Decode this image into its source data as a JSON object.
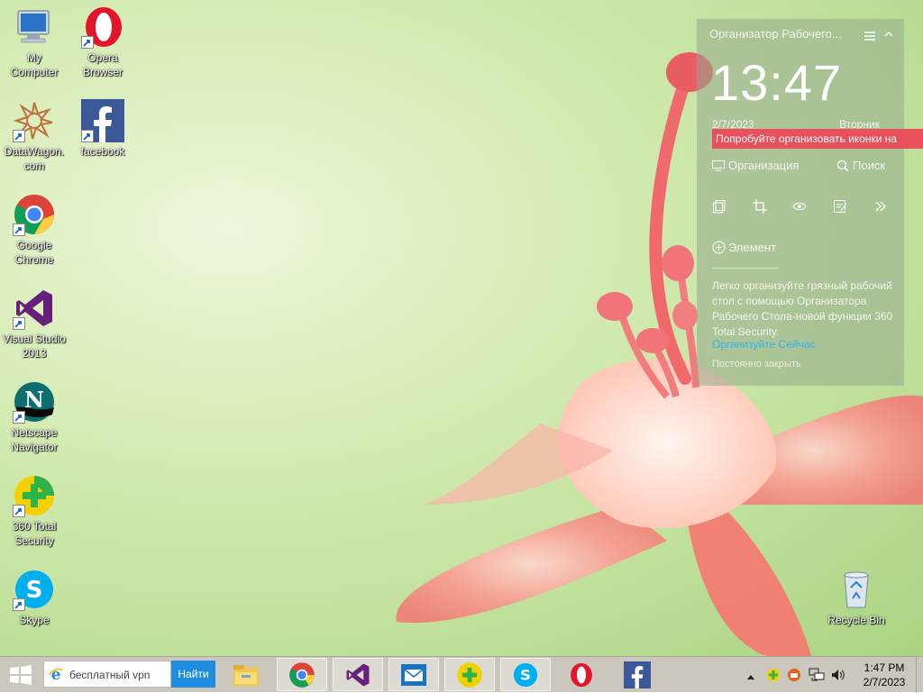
{
  "desktop": {
    "icons": [
      {
        "label": "My\nComputer"
      },
      {
        "label": "Opera\nBrowser"
      },
      {
        "label": "DataWagon.\ncom"
      },
      {
        "label": "facebook"
      },
      {
        "label": "Google\nChrome"
      },
      {
        "label": "Visual Studio\n2013"
      },
      {
        "label": "Netscape\nNavigator"
      },
      {
        "label": "360 Total\nSecurity"
      },
      {
        "label": "Skype"
      },
      {
        "label": "Recycle Bin"
      }
    ]
  },
  "organizer": {
    "title": "Организатор Рабочего...",
    "time": "13:47",
    "date": "2/7/2023",
    "weekday": "Вторник",
    "tip": "Попробуйте организовать иконки на",
    "organize_label": "Организация",
    "search_label": "Поиск",
    "element_label": "Элемент",
    "description": "Легко организуйте грязный рабочий стол с помощью Организатора Рабочего Стола-новой функции 360 Total Security.",
    "organize_now": "Организуйте Сейчас",
    "close_forever": "Постоянно закрыть"
  },
  "taskbar": {
    "search_value": "бесплатный vpn",
    "search_button": "Найти",
    "clock_time": "1:47 PM",
    "clock_date": "2/7/2023",
    "apps": [
      "file-explorer",
      "chrome",
      "visual-studio",
      "mail",
      "360-total-security",
      "skype",
      "opera",
      "facebook"
    ]
  },
  "colors": {
    "tip_bg": "#e8505b",
    "link": "#2fb6e8",
    "find_button": "#1f8ee0"
  }
}
